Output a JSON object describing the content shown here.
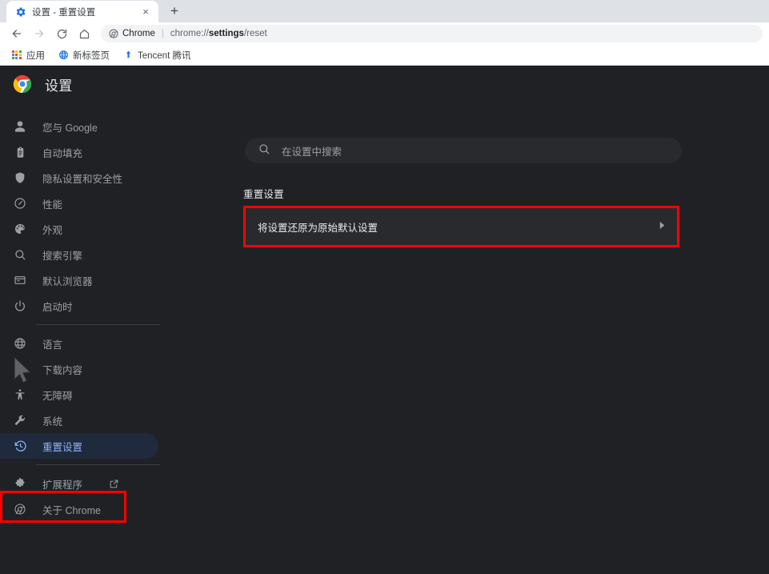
{
  "browser": {
    "tab": {
      "title": "设置 - 重置设置",
      "favicon": "settings-gear-icon",
      "close_label": "×"
    },
    "newtab_label": "+",
    "nav": {
      "back": "back-arrow-icon",
      "forward": "forward-arrow-icon",
      "reload": "reload-icon",
      "home": "home-icon"
    },
    "omnibox": {
      "chip_label": "Chrome",
      "separator": "|",
      "url_prefix": "chrome://",
      "url_bold": "settings",
      "url_suffix": "/reset"
    },
    "bookmarks": [
      {
        "label": "应用",
        "icon": "apps-grid-icon"
      },
      {
        "label": "新标签页",
        "icon": "globe-icon"
      },
      {
        "label": "Tencent 腾讯",
        "icon": "tencent-arrow-icon"
      }
    ]
  },
  "sidebar": {
    "logo": "chrome-logo-icon",
    "title": "设置",
    "items": [
      {
        "label": "您与 Google",
        "icon": "person-icon"
      },
      {
        "label": "自动填充",
        "icon": "clipboard-icon"
      },
      {
        "label": "隐私设置和安全性",
        "icon": "shield-icon"
      },
      {
        "label": "性能",
        "icon": "speedometer-icon"
      },
      {
        "label": "外观",
        "icon": "palette-icon"
      },
      {
        "label": "搜索引擎",
        "icon": "search-icon"
      },
      {
        "label": "默认浏览器",
        "icon": "browser-window-icon"
      },
      {
        "label": "启动时",
        "icon": "power-icon"
      },
      {
        "label": "语言",
        "icon": "globe-icon"
      },
      {
        "label": "下载内容",
        "icon": "download-icon"
      },
      {
        "label": "无障碍",
        "icon": "accessibility-icon"
      },
      {
        "label": "系统",
        "icon": "wrench-icon"
      },
      {
        "label": "重置设置",
        "icon": "clock-rewind-icon",
        "selected": true
      },
      {
        "label": "扩展程序",
        "icon": "puzzle-icon",
        "external": "external-link-icon"
      },
      {
        "label": "关于 Chrome",
        "icon": "chrome-outline-icon"
      }
    ]
  },
  "main": {
    "search": {
      "placeholder": "在设置中搜索",
      "icon": "search-icon"
    },
    "section_heading": "重置设置",
    "reset_row": {
      "label": "将设置还原为原始默认设置",
      "chevron": "chevron-right-icon"
    }
  },
  "colors": {
    "annotation": "#ff0000",
    "accent_blue": "#8ab4f8",
    "selected_bg": "#1f2a3d",
    "page_bg": "#202124",
    "card_bg": "#292a2d"
  }
}
